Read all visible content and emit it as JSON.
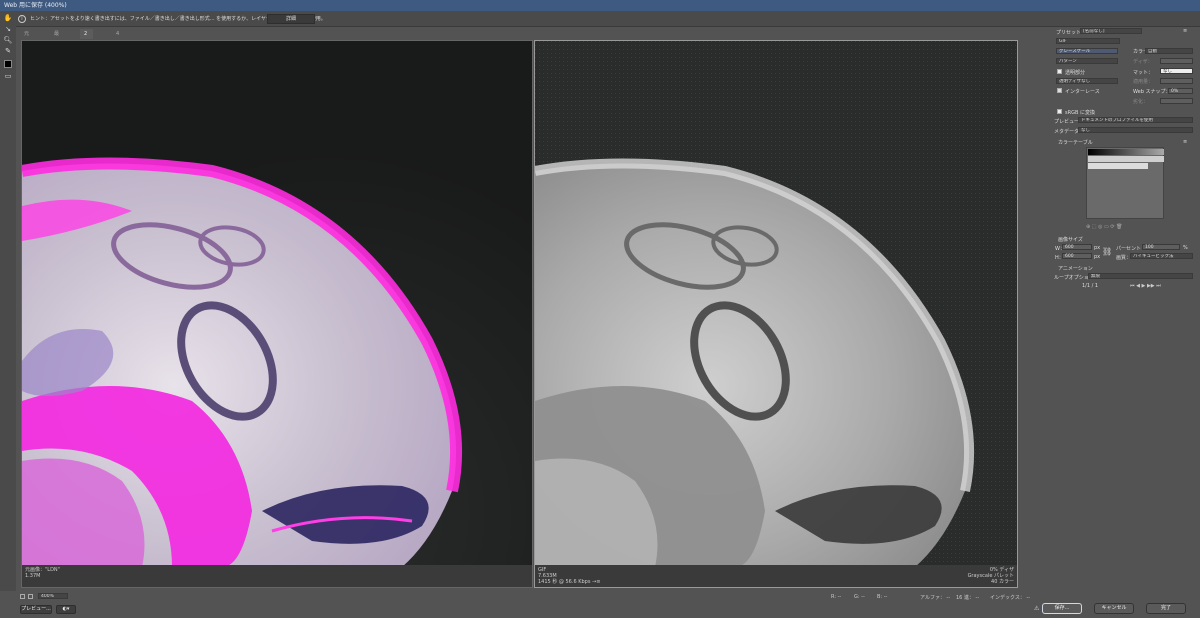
{
  "window": {
    "title": "Web 用に保存 (400%)"
  },
  "hint": {
    "icon": "info-icon",
    "text": "ヒント：アセットをより速く書き出すには、ファイル／書き出し／書き出し形式... を使用するか、レイヤーを右クリックして使用。",
    "detail_button": "詳細"
  },
  "tabs": [
    "元画像",
    "最適化",
    "2 アップ",
    "4 アップ"
  ],
  "active_tab": 2,
  "left_panel": {
    "line1": "元画像：\"LDN\"",
    "line2": "1.37M"
  },
  "right_panel": {
    "line1": "GIF",
    "line2": "7.633M",
    "line3": "1415 秒 @ 56.6 Kbps",
    "line3_icon": "arrow-menu-icon",
    "r1": "0% ディザ",
    "r2": "Grayscale パレット",
    "r3": "40 カラー"
  },
  "bottombar": {
    "zoom": "400%",
    "readouts": [
      "R: --",
      "G: --",
      "B: --",
      "アルファ： --",
      "16 進： --",
      "インデックス： --"
    ],
    "preview_button": "プレビュー...",
    "browser_icon": "browser-icon"
  },
  "settings": {
    "preset_label": "プリセット：",
    "preset_value": "[名前なし]",
    "format": "GIF",
    "reduction": "グレースケール",
    "dither_algo": "パターン",
    "colors_label": "カラー：",
    "colors_value": "自動",
    "dither_label": "ディザ：",
    "transparency_label": "透明部分",
    "matte_label": "マット：",
    "matte_value": "なし",
    "trans_dither": "透明ディザなし",
    "amount_label": "適用量：",
    "interlace_label": "インターレース",
    "websnap_label": "Web スナップ：",
    "websnap_value": "0%",
    "lossy_label": "劣化：",
    "srgb_label": "sRGB に変換",
    "preview_label": "プレビュー：",
    "preview_value": "ドキュメントのプロファイルを使用",
    "metadata_label": "メタデータ：",
    "metadata_value": "なし",
    "colortable_label": "カラーテーブル",
    "imagesize_label": "画像サイズ",
    "w_label": "W：",
    "w_value": "600",
    "h_label": "H：",
    "h_value": "600",
    "px": "px",
    "percent_label": "パーセント：",
    "percent_value": "100",
    "pct": "%",
    "quality_label": "画質：",
    "quality_value": "バイキュービック法",
    "animation_label": "アニメーション",
    "loop_label": "ループオプション：",
    "loop_value": "無限",
    "frame": "1/1 / 1"
  },
  "footer": {
    "save": "保存...",
    "cancel": "キャンセル",
    "done": "完了"
  }
}
